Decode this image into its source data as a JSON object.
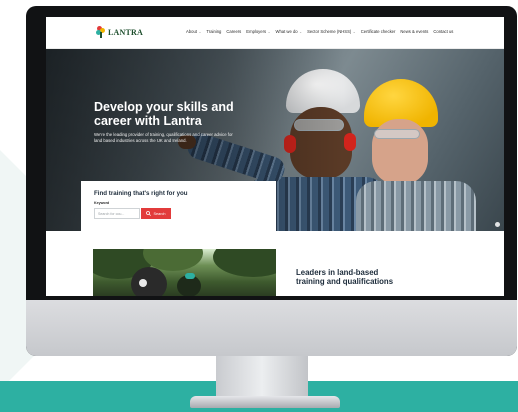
{
  "site": {
    "logo_text": "LANTRA",
    "nav": [
      {
        "label": "About",
        "has_dropdown": true
      },
      {
        "label": "Training",
        "has_dropdown": false
      },
      {
        "label": "Careers",
        "has_dropdown": false
      },
      {
        "label": "Employers",
        "has_dropdown": true
      },
      {
        "label": "What we do",
        "has_dropdown": true
      },
      {
        "label": "Sector Scheme (NHSS)",
        "has_dropdown": true
      },
      {
        "label": "Certificate checker",
        "has_dropdown": false
      },
      {
        "label": "News & events",
        "has_dropdown": false
      },
      {
        "label": "Contact us",
        "has_dropdown": false
      }
    ]
  },
  "hero": {
    "title": "Develop your skills and career with Lantra",
    "body": "We're the leading provider of training, qualifications and career advice for land based industries across the UK and Ireland."
  },
  "search": {
    "heading": "Find training that's right for you",
    "keyword_label": "Keyword",
    "placeholder": "Search for cou...",
    "button_label": "Search"
  },
  "section": {
    "heading": "Leaders in land-based training and qualifications"
  },
  "colors": {
    "accent_red": "#e23b3b",
    "teal_band": "#2db0a2",
    "brand_green": "#1d4e2c",
    "hard_hat_yellow": "#f0b400"
  }
}
